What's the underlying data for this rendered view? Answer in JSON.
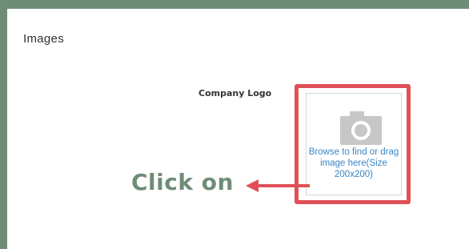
{
  "section": {
    "title": "Images"
  },
  "logo_field": {
    "label": "Company Logo",
    "dropzone_text": "Browse to find or drag image here(Size 200x200)"
  },
  "annotation": {
    "text": "Click on"
  },
  "icons": {
    "upload": "camera-icon",
    "pointer": "arrow-left-icon"
  },
  "colors": {
    "frame": "#6f8c76",
    "highlight": "#e05157",
    "link_text": "#3a86c4",
    "annotation": "#6f8c76"
  }
}
